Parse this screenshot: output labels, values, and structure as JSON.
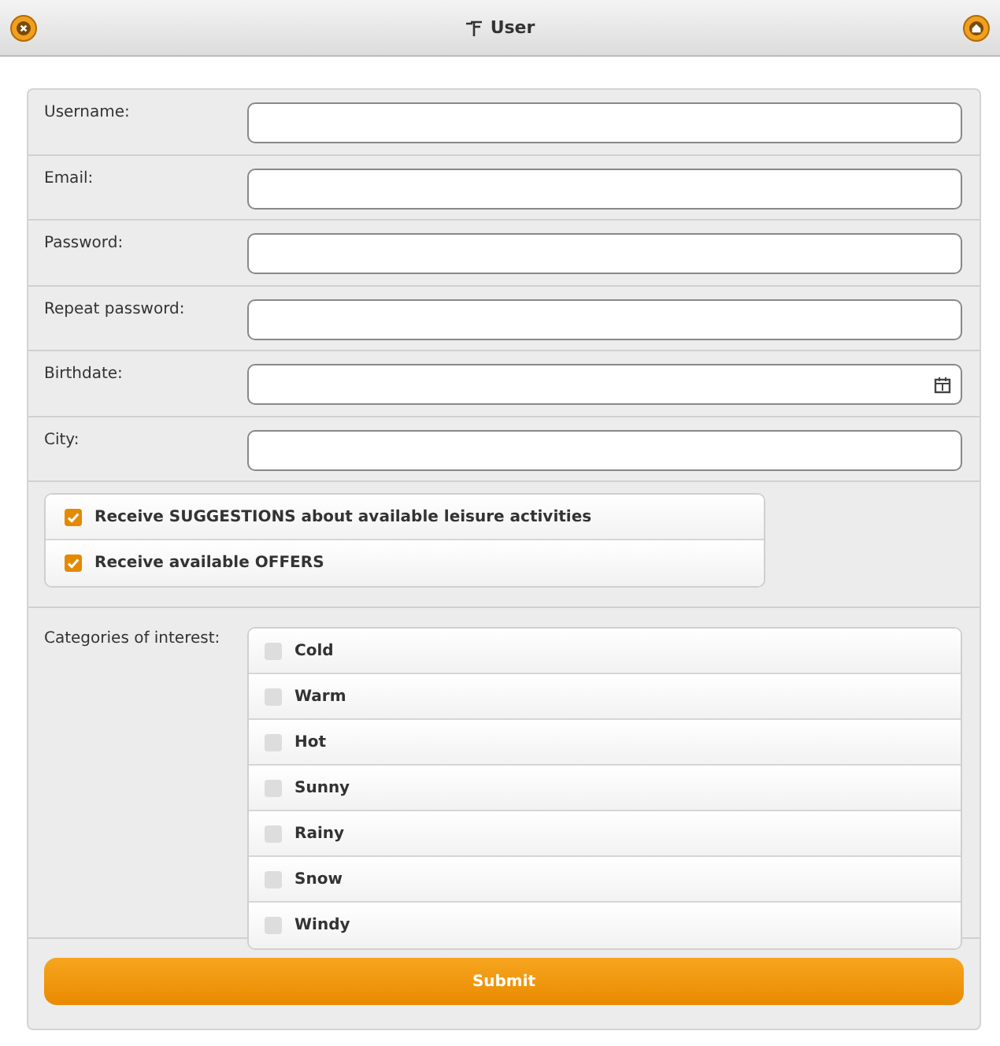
{
  "window": {
    "title": "User"
  },
  "fields": [
    {
      "label": "Username:",
      "kind": "text"
    },
    {
      "label": "Email:",
      "kind": "text"
    },
    {
      "label": "Password:",
      "kind": "text"
    },
    {
      "label": "Repeat password:",
      "kind": "text"
    },
    {
      "label": "Birthdate:",
      "kind": "date"
    },
    {
      "label": "City:",
      "kind": "text"
    }
  ],
  "options": [
    {
      "label": "Receive SUGGESTIONS about available leisure activities",
      "checked": true
    },
    {
      "label": "Receive available OFFERS",
      "checked": true
    }
  ],
  "categories": {
    "label": "Categories of interest:",
    "items": [
      {
        "label": "Cold",
        "checked": false
      },
      {
        "label": "Warm",
        "checked": false
      },
      {
        "label": "Hot",
        "checked": false
      },
      {
        "label": "Sunny",
        "checked": false
      },
      {
        "label": "Rainy",
        "checked": false
      },
      {
        "label": "Snow",
        "checked": false
      },
      {
        "label": "Windy",
        "checked": false
      }
    ]
  },
  "submit": "Submit"
}
